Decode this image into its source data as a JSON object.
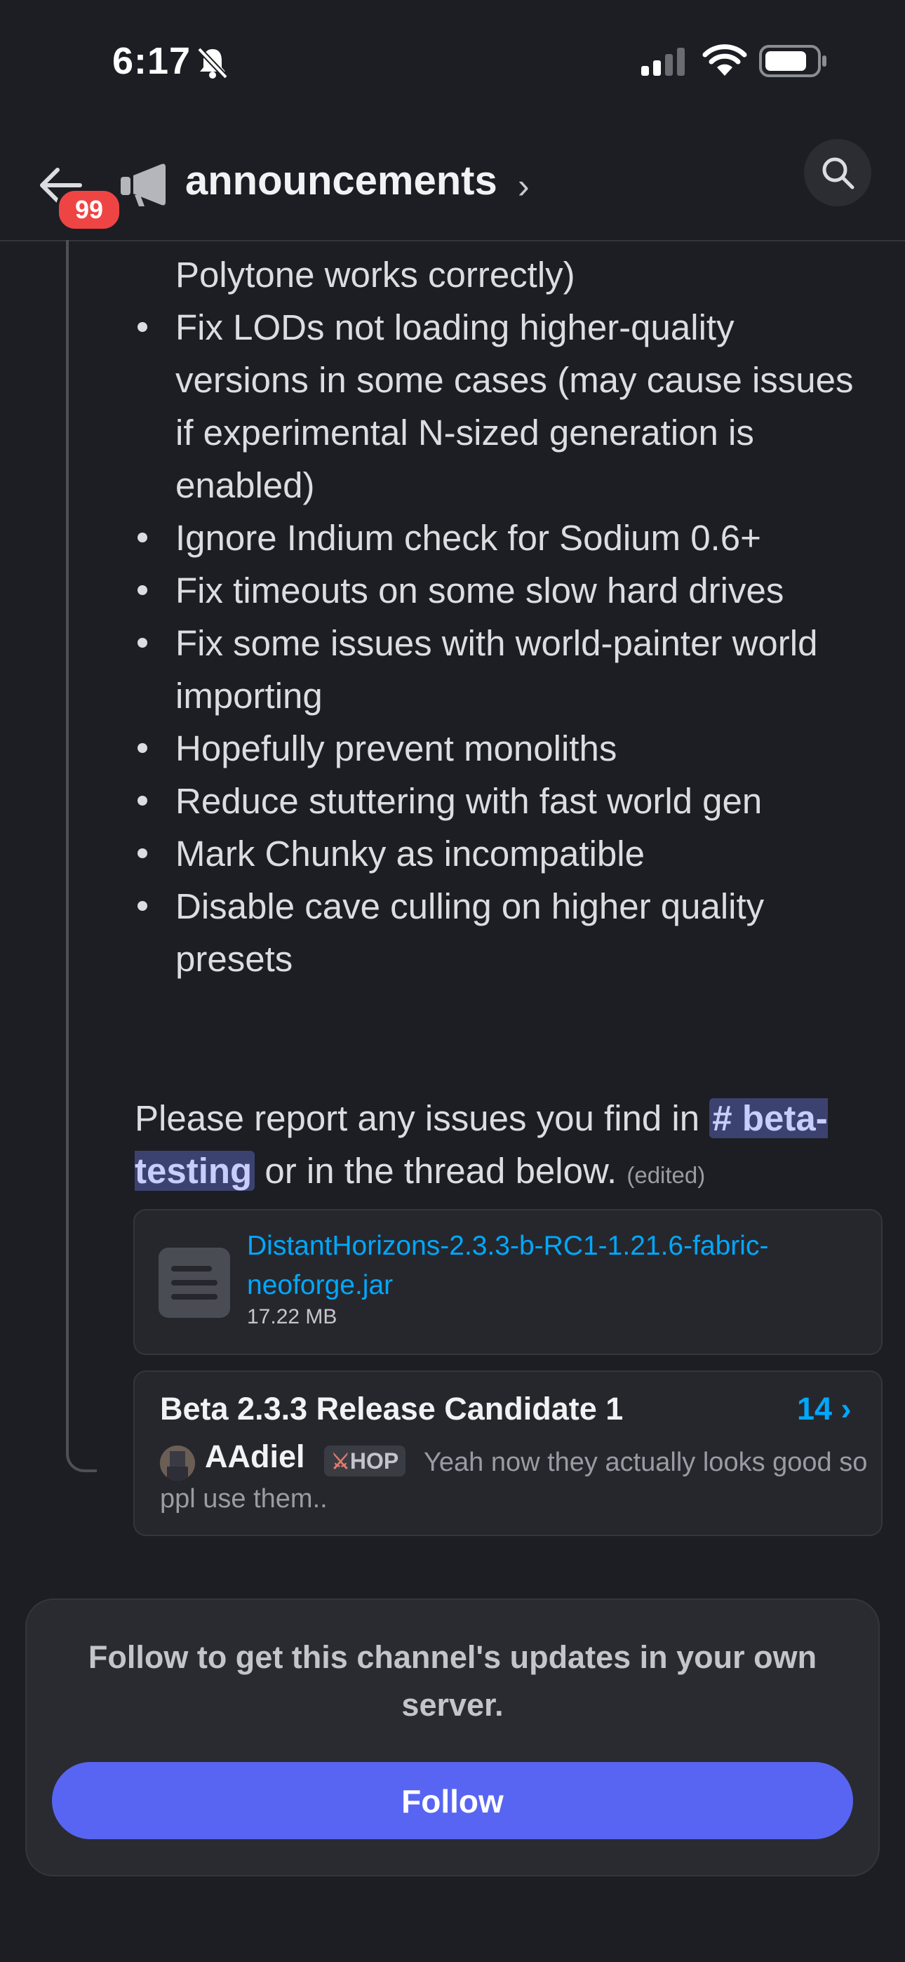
{
  "status_bar": {
    "time": "6:17"
  },
  "header": {
    "back_badge": "99",
    "channel_name": "announcements",
    "chevron": "›"
  },
  "message": {
    "lines": [
      {
        "text": "Polytone works correctly)",
        "bullet": false
      },
      {
        "text": "Fix LODs not loading higher-quality",
        "bullet": true
      },
      {
        "text": "versions in some cases (may cause issues",
        "bullet": false
      },
      {
        "text": "if experimental N-sized generation is",
        "bullet": false
      },
      {
        "text": "enabled)",
        "bullet": false
      },
      {
        "text": "Ignore Indium check for Sodium 0.6+",
        "bullet": true
      },
      {
        "text": "Fix timeouts on some slow hard drives",
        "bullet": true
      },
      {
        "text": "Fix some issues with world-painter world",
        "bullet": true
      },
      {
        "text": "importing",
        "bullet": false
      },
      {
        "text": "Hopefully prevent monoliths",
        "bullet": true
      },
      {
        "text": "Reduce stuttering with fast world gen",
        "bullet": true
      },
      {
        "text": "Mark Chunky as incompatible",
        "bullet": true
      },
      {
        "text": "Disable cave culling on higher quality",
        "bullet": true
      },
      {
        "text": "presets",
        "bullet": false
      }
    ],
    "report_prefix": "Please report any issues you find in ",
    "channel_mention": "# beta-testing",
    "report_suffix": " or in the thread below.",
    "edited": "(edited)"
  },
  "attachment": {
    "file_name": "DistantHorizons-2.3.3-b-RC1-1.21.6-fabric-neoforge.jar",
    "file_size": "17.22 MB",
    "icon": "file-text-icon"
  },
  "thread": {
    "title": "Beta 2.3.3 Release Candidate 1",
    "count": "14 ›",
    "author": "AAdiel",
    "role_tag": "HOP",
    "preview": "Yeah now they actually looks good so ppl use them.."
  },
  "follow": {
    "text": "Follow to get this channel's updates in your own server.",
    "button_label": "Follow"
  },
  "colors": {
    "background": "#1d1e23",
    "accent": "#5865f2",
    "link": "#00a8fc",
    "badge": "#ef4444"
  }
}
